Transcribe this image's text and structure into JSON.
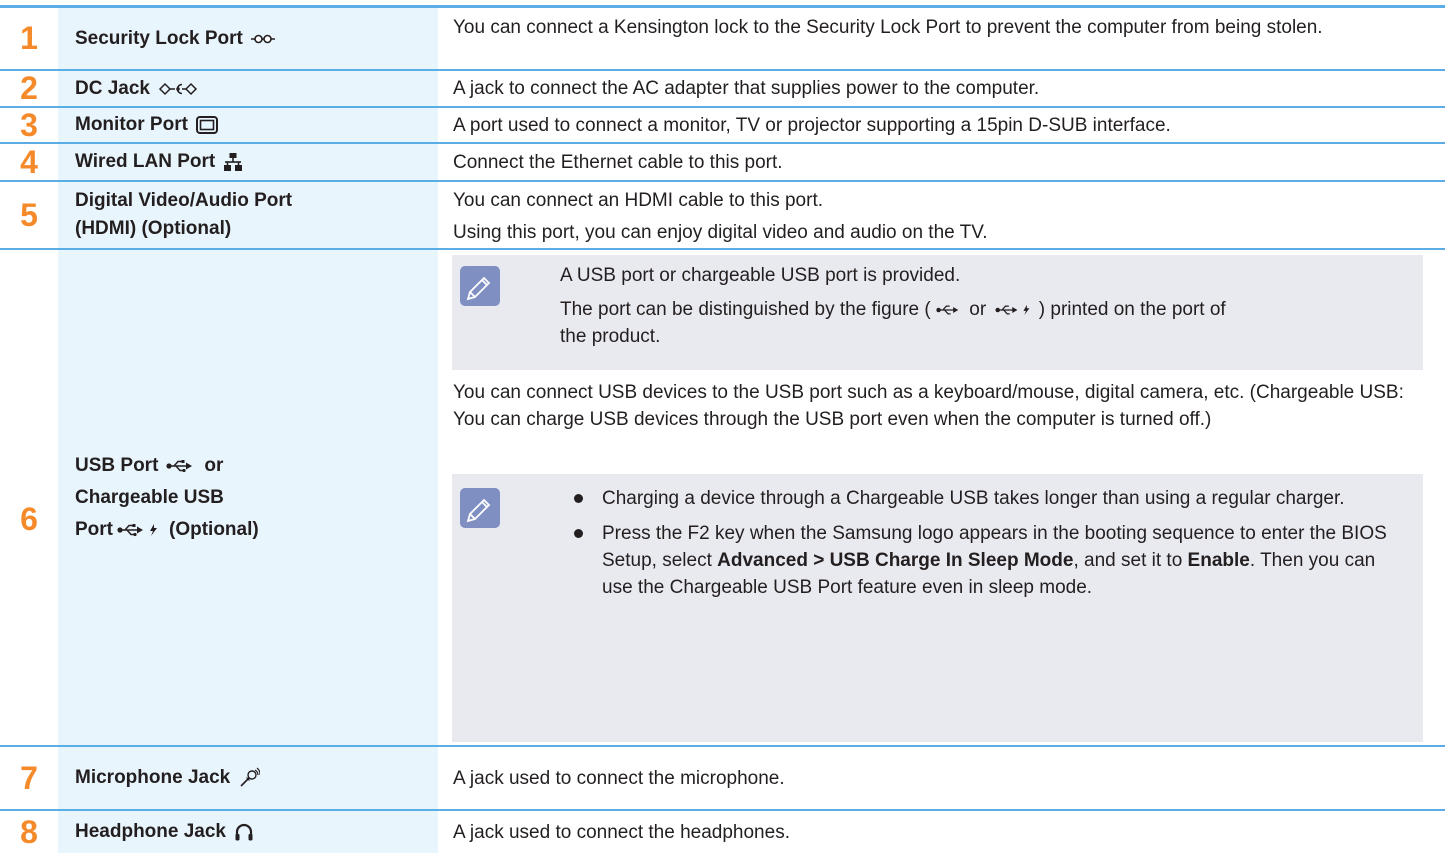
{
  "rows": [
    {
      "num": "1",
      "name": "Security Lock Port",
      "icon": "kensington-lock-icon",
      "desc": "You can connect a Kensington lock to the Security Lock Port to prevent the computer from being stolen."
    },
    {
      "num": "2",
      "name": "DC Jack",
      "icon": "dc-polarity-icon",
      "desc": "A jack to connect the AC adapter that supplies power to the computer."
    },
    {
      "num": "3",
      "name": "Monitor Port",
      "icon": "monitor-icon",
      "desc": "A port used to connect a monitor, TV or projector supporting a 15pin D-SUB interface."
    },
    {
      "num": "4",
      "name": "Wired LAN Port",
      "icon": "network-icon",
      "desc": "Connect the Ethernet cable to this port."
    },
    {
      "num": "5",
      "name_line1": "Digital Video/Audio Port",
      "name_line2": "(HDMI) (Optional)",
      "desc_line1": "You can connect an HDMI cable to this port.",
      "desc_line2": "Using this port, you can enjoy digital video and audio on the TV."
    },
    {
      "num": "6",
      "name_line1": "USB Port",
      "name_or": "or",
      "name_line2": "Chargeable USB",
      "name_line3": "Port",
      "name_optional": "(Optional)",
      "note1_line1": "A USB port or chargeable USB port is provided.",
      "note1_line2_a": "The port can be distinguished by the figure (",
      "note1_line2_or": "or",
      "note1_line2_b": ") printed on the port of",
      "note1_line3": "the product.",
      "desc": "You can connect USB devices to the USB port such as a keyboard/mouse, digital camera, etc. (Chargeable USB: You can charge USB devices through the USB port even when the computer is turned off.)",
      "bullet1": "Charging a device through a Chargeable USB takes longer than using a regular charger.",
      "bullet2_a": "Press the F2 key when the Samsung logo appears in the booting sequence to enter the BIOS Setup, select",
      "bullet2_b1": "Advanced > USB Charge In Sleep Mode",
      "bullet2_c": ", and set it to",
      "bullet2_b2": "Enable",
      "bullet2_d": ". Then you can use the Chargeable USB Port feature even in sleep mode."
    },
    {
      "num": "7",
      "name": "Microphone Jack",
      "icon": "microphone-icon",
      "desc": "A jack used to connect the microphone."
    },
    {
      "num": "8",
      "name": "Headphone Jack",
      "icon": "headphone-icon",
      "desc": "A jack used to connect the headphones."
    }
  ],
  "colors": {
    "number": "#f58a2b",
    "rule": "#5aaee5",
    "name_bg": "#e9f5fc",
    "note_bg": "#e9eaf0",
    "note_icon": "#7f8fc2"
  }
}
